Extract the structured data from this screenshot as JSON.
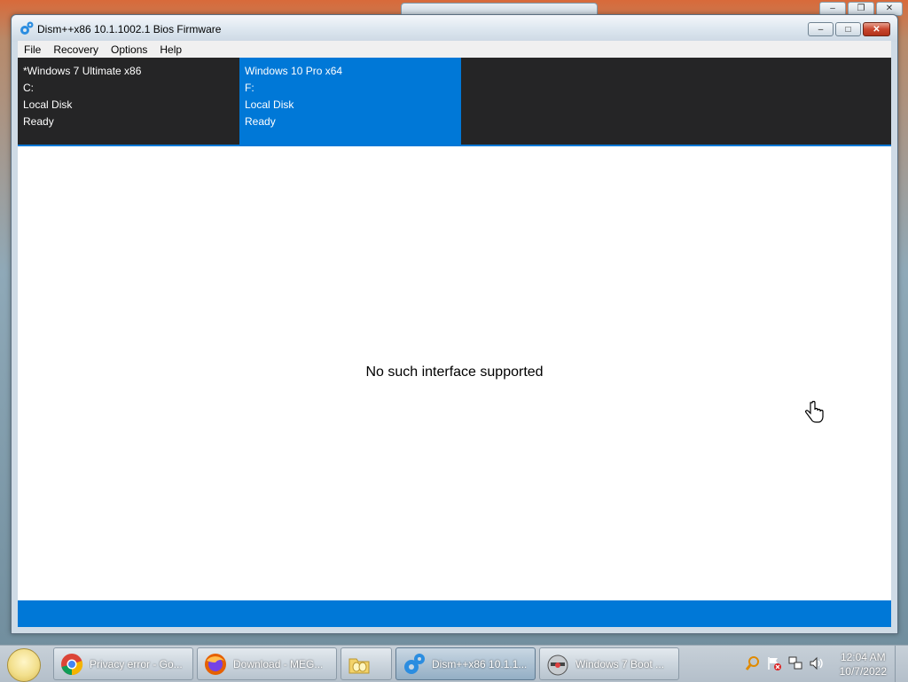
{
  "window": {
    "title": "Dism++x86 10.1.1002.1 Bios Firmware",
    "controls": {
      "minimize": "–",
      "maximize": "□",
      "close": "✕"
    }
  },
  "menu": [
    "File",
    "Recovery",
    "Options",
    "Help"
  ],
  "drives": [
    {
      "os": "*Windows 7 Ultimate x86",
      "letter": "C:",
      "type": "Local Disk",
      "status": "Ready",
      "selected": false
    },
    {
      "os": "Windows 10 Pro x64",
      "letter": "F:",
      "type": "Local Disk",
      "status": "Ready",
      "selected": true
    }
  ],
  "main": {
    "message": "No such interface supported"
  },
  "taskbar": {
    "tasks": [
      {
        "label": "Privacy error - Go...",
        "icon": "chrome-icon"
      },
      {
        "label": "Download - MEG...",
        "icon": "firefox-icon"
      },
      {
        "label": "",
        "icon": "folder-icon"
      },
      {
        "label": "Dism++x86 10.1.1...",
        "icon": "gear-icon"
      },
      {
        "label": "Windows 7 Boot ...",
        "icon": "boot-disk-icon"
      }
    ],
    "clock": {
      "time": "12:04 AM",
      "date": "10/7/2022"
    }
  },
  "colors": {
    "accent": "#0078d7",
    "drive_bar": "#252526"
  }
}
